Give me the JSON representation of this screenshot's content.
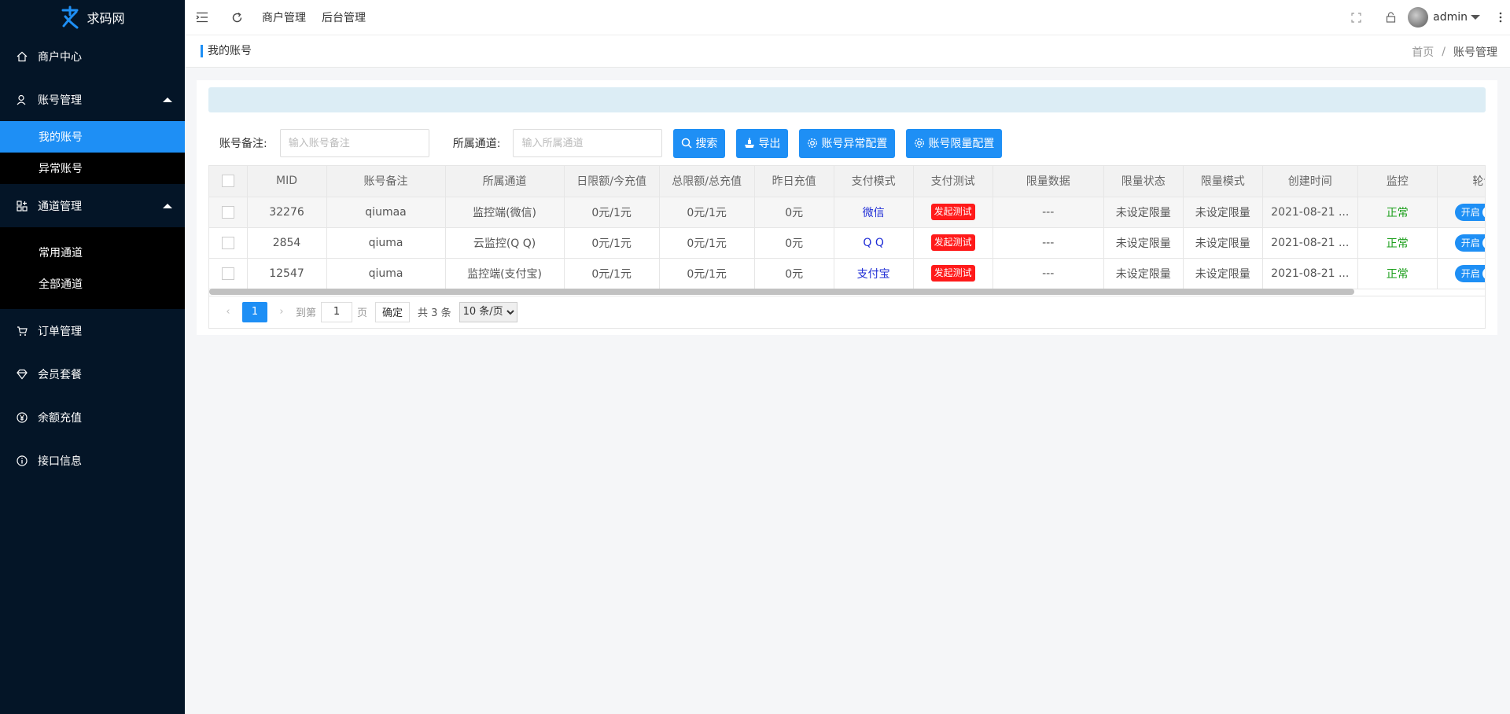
{
  "app": {
    "logo_text": "求码网"
  },
  "sidebar": {
    "items": [
      {
        "label": "商户中心",
        "icon": "home-icon"
      },
      {
        "label": "账号管理",
        "icon": "user-icon"
      },
      {
        "label": "通道管理",
        "icon": "grid-plus-icon"
      },
      {
        "label": "订单管理",
        "icon": "cart-icon"
      },
      {
        "label": "会员套餐",
        "icon": "diamond-icon"
      },
      {
        "label": "余额充值",
        "icon": "yen-icon"
      },
      {
        "label": "接口信息",
        "icon": "info-icon"
      }
    ],
    "account_sub": [
      "我的账号",
      "异常账号"
    ],
    "channel_sub": [
      "常用通道",
      "全部通道"
    ]
  },
  "header": {
    "links": [
      "商户管理",
      "后台管理"
    ],
    "user": "admin"
  },
  "breadcrumb": {
    "title": "我的账号",
    "home": "首页",
    "sep": "/",
    "current": "账号管理"
  },
  "filters": {
    "remark_label": "账号备注:",
    "remark_placeholder": "输入账号备注",
    "channel_label": "所属通道:",
    "channel_placeholder": "输入所属通道",
    "search": "搜索",
    "export": "导出",
    "abnormal_config": "账号异常配置",
    "limit_config": "账号限量配置"
  },
  "table": {
    "columns": [
      "MID",
      "账号备注",
      "所属通道",
      "日限额/今充值",
      "总限额/总充值",
      "昨日充值",
      "支付模式",
      "支付测试",
      "限量数据",
      "限量状态",
      "限量模式",
      "创建时间",
      "监控",
      "轮询"
    ],
    "rows": [
      {
        "mid": "32276",
        "remark": "qiumaa",
        "channel": "监控端(微信)",
        "daily": "0元/1元",
        "total": "0元/1元",
        "yesterday": "0元",
        "mode": "微信",
        "test": "发起测试",
        "limit_data": "---",
        "limit_status": "未设定限量",
        "limit_mode": "未设定限量",
        "created": "2021-08-21 ...",
        "monitor": "正常",
        "poll": "开启"
      },
      {
        "mid": "2854",
        "remark": "qiuma",
        "channel": "云监控(Q Q)",
        "daily": "0元/1元",
        "total": "0元/1元",
        "yesterday": "0元",
        "mode": "Q Q",
        "test": "发起测试",
        "limit_data": "---",
        "limit_status": "未设定限量",
        "limit_mode": "未设定限量",
        "created": "2021-08-21 ...",
        "monitor": "正常",
        "poll": "开启"
      },
      {
        "mid": "12547",
        "remark": "qiuma",
        "channel": "监控端(支付宝)",
        "daily": "0元/1元",
        "total": "0元/1元",
        "yesterday": "0元",
        "mode": "支付宝",
        "test": "发起测试",
        "limit_data": "---",
        "limit_status": "未设定限量",
        "limit_mode": "未设定限量",
        "created": "2021-08-21 ...",
        "monitor": "正常",
        "poll": "开启"
      }
    ]
  },
  "pager": {
    "current": "1",
    "goto": "到第",
    "page_value": "1",
    "page_unit": "页",
    "confirm": "确定",
    "total": "共 3 条",
    "page_size": "10 条/页"
  },
  "colors": {
    "primary": "#1e8ff5",
    "sidebar": "#041527",
    "danger": "#ff1a1a",
    "success": "#1a9e1a"
  }
}
